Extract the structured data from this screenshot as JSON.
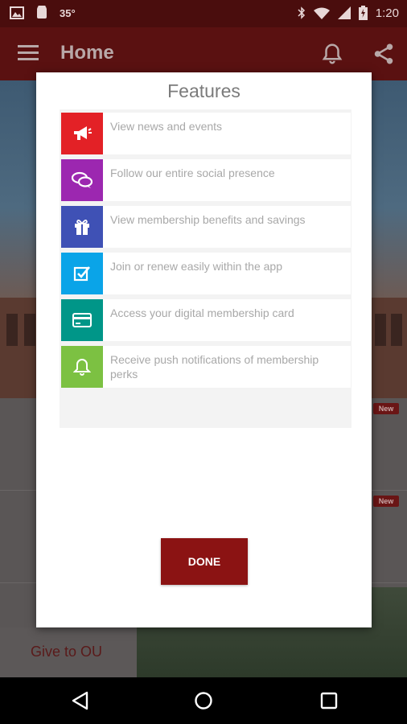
{
  "status_bar": {
    "temperature": "35°",
    "time": "1:20"
  },
  "app_bar": {
    "title": "Home",
    "icons": [
      "menu-icon",
      "bell-icon",
      "share-icon"
    ]
  },
  "background": {
    "badges": [
      "New",
      "New"
    ],
    "give_label": "Give to OU"
  },
  "dialog": {
    "title": "Features",
    "features": [
      {
        "text": "View news and events",
        "icon": "megaphone-icon",
        "color": "#e32126"
      },
      {
        "text": "Follow our entire social presence",
        "icon": "chat-bubbles-icon",
        "color": "#9c27b0"
      },
      {
        "text": "View membership benefits and savings",
        "icon": "gift-icon",
        "color": "#3f51b5"
      },
      {
        "text": "Join or renew easily within the app",
        "icon": "checkbox-icon",
        "color": "#0aa4e8"
      },
      {
        "text": "Access your digital membership card",
        "icon": "credit-card-icon",
        "color": "#009688"
      },
      {
        "text": "Receive push notifications of membership perks",
        "icon": "bell-icon",
        "color": "#7cc142"
      }
    ],
    "done_label": "DONE",
    "done_color": "#8b1313"
  },
  "nav_bar": {
    "buttons": [
      "back-icon",
      "home-icon",
      "recents-icon"
    ]
  }
}
